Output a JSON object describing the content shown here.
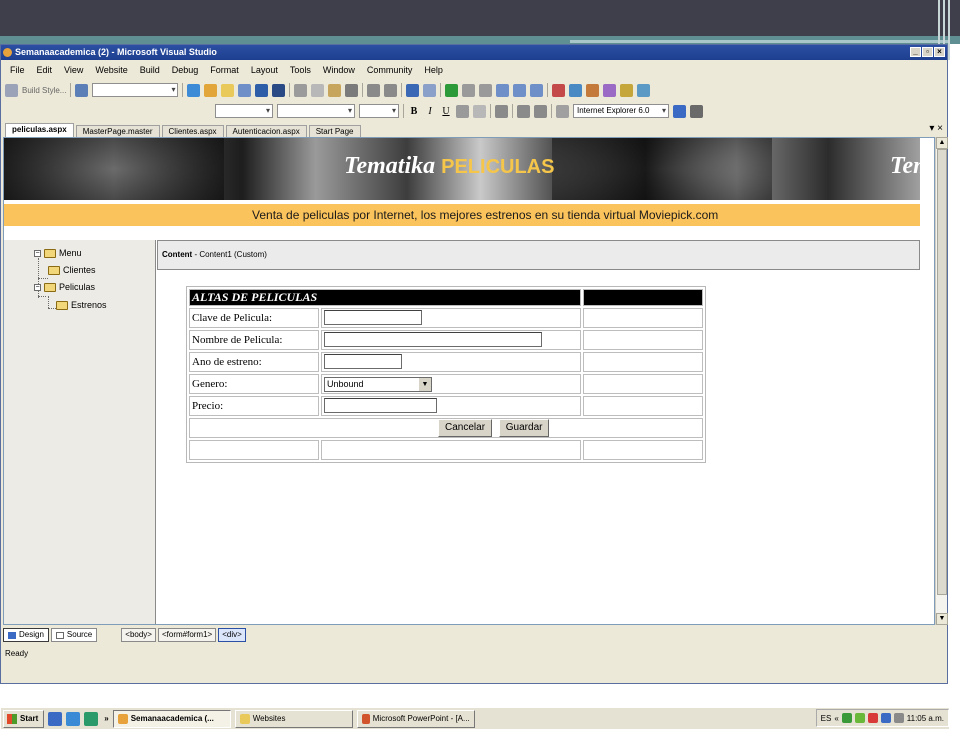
{
  "window": {
    "title": "Semanaacademica (2) - Microsoft Visual Studio"
  },
  "menu": [
    "File",
    "Edit",
    "View",
    "Website",
    "Build",
    "Debug",
    "Format",
    "Layout",
    "Tools",
    "Window",
    "Community",
    "Help"
  ],
  "toolbar": {
    "build_style": "Build Style...",
    "target_browser": "Internet Explorer 6.0",
    "bold": "B",
    "italic": "I",
    "underline": "U"
  },
  "tabs": [
    "peliculas.aspx",
    "MasterPage.master",
    "Clientes.aspx",
    "Autenticacion.aspx",
    "Start Page"
  ],
  "banner": {
    "brand_main": "Tematika",
    "brand_accent": "PELICULAS",
    "brand_repeat": "Tem"
  },
  "tagline": "Venta de peliculas por Internet, los mejores estrenos en su tienda virtual Moviepick.com",
  "tree": {
    "root": "Menu",
    "items": [
      "Clientes",
      "Peliculas",
      "Estrenos"
    ]
  },
  "content": {
    "label": "Content",
    "detail": " - Content1 (Custom)"
  },
  "form": {
    "header": "ALTAS DE PELICULAS",
    "rows": [
      {
        "label": "Clave de Pelicula:"
      },
      {
        "label": "Nombre de Pelicula:"
      },
      {
        "label": "Ano de estreno:"
      },
      {
        "label": "Genero:",
        "value": "Unbound"
      },
      {
        "label": "Precio:"
      }
    ],
    "cancel": "Cancelar",
    "save": "Guardar"
  },
  "viewbar": {
    "design": "Design",
    "source": "Source",
    "crumbs": [
      "<body>",
      "<form#form1>",
      "<div>"
    ]
  },
  "status": "Ready",
  "taskbar": {
    "start": "Start",
    "buttons": [
      "Semanaacademica (...",
      "Websites",
      "Microsoft PowerPoint - [A..."
    ],
    "lang": "ES",
    "time": "11:05 a.m."
  },
  "colors": {
    "tagline_bg": "#fbc35b",
    "brand_accent": "#f6c64a",
    "title_bar": "#1e3f8f"
  }
}
